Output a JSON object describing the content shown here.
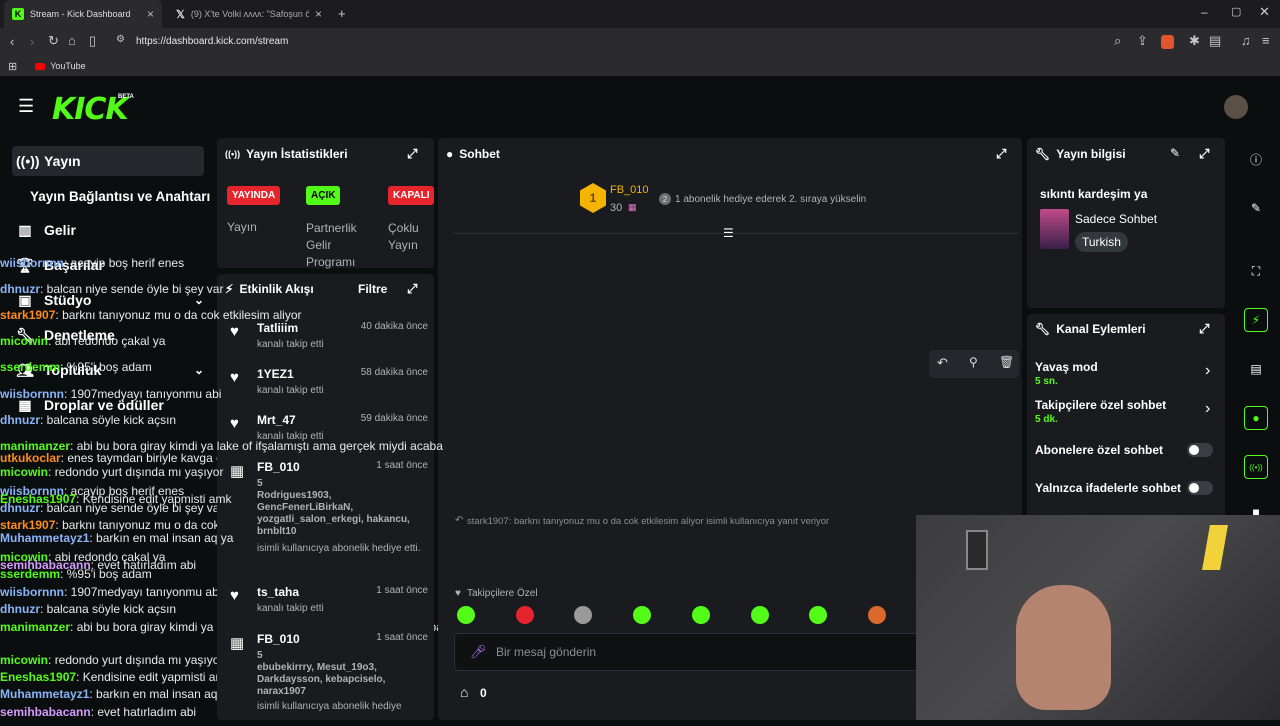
{
  "browser": {
    "tabs": [
      {
        "title": "Stream - Kick Dashboard",
        "active": true
      },
      {
        "title": "(9) X'te Volki ᴧᴧᴧᴧ: \"Safoşun ödediği p"
      }
    ],
    "url": "https://dashboard.kick.com/stream",
    "bookmark": "YouTube"
  },
  "header": {
    "logo": "KICK",
    "beta": "BETA"
  },
  "nav": {
    "items": [
      {
        "label": "Yayın",
        "icon": "broadcast-icon"
      },
      {
        "label": "Yayın Bağlantısı ve Anahtarı",
        "icon": ""
      },
      {
        "label": "Gelir",
        "icon": "chart-icon"
      },
      {
        "label": "Başarılar",
        "icon": "trophy-icon"
      },
      {
        "label": "Stüdyo",
        "icon": "studio-icon"
      },
      {
        "label": "Denetleme",
        "icon": "wrench-icon"
      },
      {
        "label": "Topluluk",
        "icon": "people-icon"
      },
      {
        "label": "Droplar ve ödüller",
        "icon": "gift-icon"
      }
    ]
  },
  "stats": {
    "title": "Yayın İstatistikleri",
    "badges": [
      {
        "label": "YAYINDA",
        "caption": "Yayın",
        "color": "#e5242c"
      },
      {
        "label": "AÇIK",
        "caption": "Partnerlik Gelir Programı",
        "color": "#53fc18"
      },
      {
        "label": "KAPALI",
        "caption": "Çoklu Yayın",
        "color": "#e5242c"
      }
    ]
  },
  "activity": {
    "title": "Etkinlik Akışı",
    "filter": "Filtre",
    "items": [
      {
        "name": "Tatliiim",
        "time": "40 dakika önce",
        "desc": "kanalı takip etti",
        "icon": "heart-icon"
      },
      {
        "name": "1YEZ1",
        "time": "58 dakika önce",
        "desc": "kanalı takip etti",
        "icon": "heart-icon"
      },
      {
        "name": "Mrt_47",
        "time": "59 dakika önce",
        "desc": "kanalı takip etti",
        "icon": "heart-icon"
      },
      {
        "name": "FB_010",
        "time": "1 saat önce",
        "count": "5",
        "users": "Rodrigues1903, GencFenerLiBirkaN, yozgatli_salon_erkegi, hakancu, brnblt10",
        "desc": "isimli kullanıcıya abonelik hediye etti.",
        "icon": "gift-icon"
      },
      {
        "name": "ts_taha",
        "time": "1 saat önce",
        "desc": "kanalı takip etti",
        "icon": "heart-icon"
      },
      {
        "name": "FB_010",
        "time": "1 saat önce",
        "count": "5",
        "users": "ebubekirrry, Mesut_19o3, Darkdaysson, kebapciselo, narax1907",
        "desc": "isimli kullanıcıya abonelik hediye",
        "icon": "gift-icon"
      }
    ]
  },
  "chat": {
    "title": "Sohbet",
    "top_gifter": {
      "rank": "1",
      "name": "FB_010",
      "count": "30",
      "hint_rank": "2",
      "hint": "1 abonelik hediye ederek 2. sıraya yükselin"
    },
    "messages": [
      {
        "user": "wiisbornnn",
        "text": "acayip boş herif enes",
        "color": "#8ab4f8"
      },
      {
        "user": "dhnuzr",
        "text": "balcan niye sende öyle bi şey var",
        "color": "#8ab4f8"
      },
      {
        "user": "stark1907",
        "text": "barknı tanıyonuz mu o da cok etkilesim aliyor",
        "color": "#ff8c1a"
      },
      {
        "user": "micowin",
        "text": "abi redondo çakal ya",
        "color": "#53fc18"
      },
      {
        "user": "sserdemm",
        "text": "%95'i boş adam",
        "color": "#53fc18"
      },
      {
        "user": "wiisbornnn",
        "text": "1907medyayı tanıyonmu abi",
        "color": "#8ab4f8"
      },
      {
        "user": "dhnuzr",
        "text": "balcana söyle kick açsın",
        "color": "#8ab4f8"
      },
      {
        "user": "manimanzer",
        "text": "abi bu bora giray kimdi ya lake of ifşalamıştı ama gerçek miydi acaba",
        "color": "#53fc18"
      },
      {
        "user": "micowin",
        "text": "redondo yurt dışında mı yaşıyor",
        "color": "#53fc18"
      },
      {
        "user": "Eneshas1907",
        "text": "Kendisine edit yapmisti amk",
        "color": "#53fc18"
      }
    ],
    "reply_hint": "stark1907: barknı tanıyonuz mu o da cok etkilesim aliyor isimli kullanıcıya yanıt veriyor",
    "messages2": [
      {
        "user": "Muhammetayz1",
        "text": "barkın en mal insan aq ya",
        "color": "#8ab4f8"
      },
      {
        "user": "semihbabacann",
        "text": "evet hatırladım abi",
        "color": "#d59bff"
      }
    ],
    "followers_only": "Takipçilere Özel",
    "placeholder": "Bir mesaj gönderin",
    "points": "0"
  },
  "side_chat": [
    {
      "user": "utkukoclar",
      "text": "enes taymdan biriyle kavga etmişti amq",
      "color": "#ff8c1a"
    },
    {
      "user": "wiisbornnn",
      "text": "acayip boş herif enes",
      "color": "#8ab4f8"
    },
    {
      "user": "dhnuzr",
      "text": "balcan niye sende öyle bi şey var",
      "color": "#8ab4f8"
    },
    {
      "user": "stark1907",
      "text": "barknı tanıyonuz mu o da cok etkilesim aliyor",
      "color": "#ff8c1a"
    },
    {
      "user": "micowin",
      "text": "abi redondo çakal ya",
      "color": "#53fc18"
    },
    {
      "user": "sserdemm",
      "text": "%95'i boş adam",
      "color": "#53fc18"
    },
    {
      "user": "wiisbornnn",
      "text": "1907medyayı tanıyonmu abi",
      "color": "#8ab4f8"
    },
    {
      "user": "dhnuzr",
      "text": "balcana söyle kick açsın",
      "color": "#8ab4f8"
    },
    {
      "user": "manimanzer",
      "text": "abi bu bora giray kimdi ya lake of ifşalamıştı ama gerçek miydi acaba",
      "color": "#53fc18"
    },
    {
      "user": "micowin",
      "text": "redondo yurt dışında mı yaşıyor",
      "color": "#53fc18"
    },
    {
      "user": "Eneshas1907",
      "text": "Kendisine edit yapmisti amk",
      "color": "#53fc18"
    },
    {
      "user": "Muhammetayz1",
      "text": "barkın en mal insan aq ya",
      "color": "#8ab4f8"
    },
    {
      "user": "semihbabacann",
      "text": "evet hatırladım abi",
      "color": "#d59bff"
    }
  ],
  "stream_info": {
    "title": "Yayın bilgisi",
    "stream_title": "sıkıntı kardeşim ya",
    "category": "Sadece Sohbet",
    "language": "Turkish"
  },
  "channel_actions": {
    "title": "Kanal Eylemleri",
    "items": [
      {
        "label": "Yavaş mod",
        "value": "5 sn.",
        "type": "chevron"
      },
      {
        "label": "Takipçilere özel sohbet",
        "value": "5 dk.",
        "type": "chevron"
      },
      {
        "label": "Abonelere özel sohbet",
        "value": "",
        "type": "toggle"
      },
      {
        "label": "Yalnızca ifadelerle sohbet",
        "value": "",
        "type": "toggle"
      }
    ]
  },
  "colors": {
    "accent": "#53fc18",
    "live": "#e5242c",
    "panel": "#191b1f",
    "bg": "#0b0e0f"
  }
}
